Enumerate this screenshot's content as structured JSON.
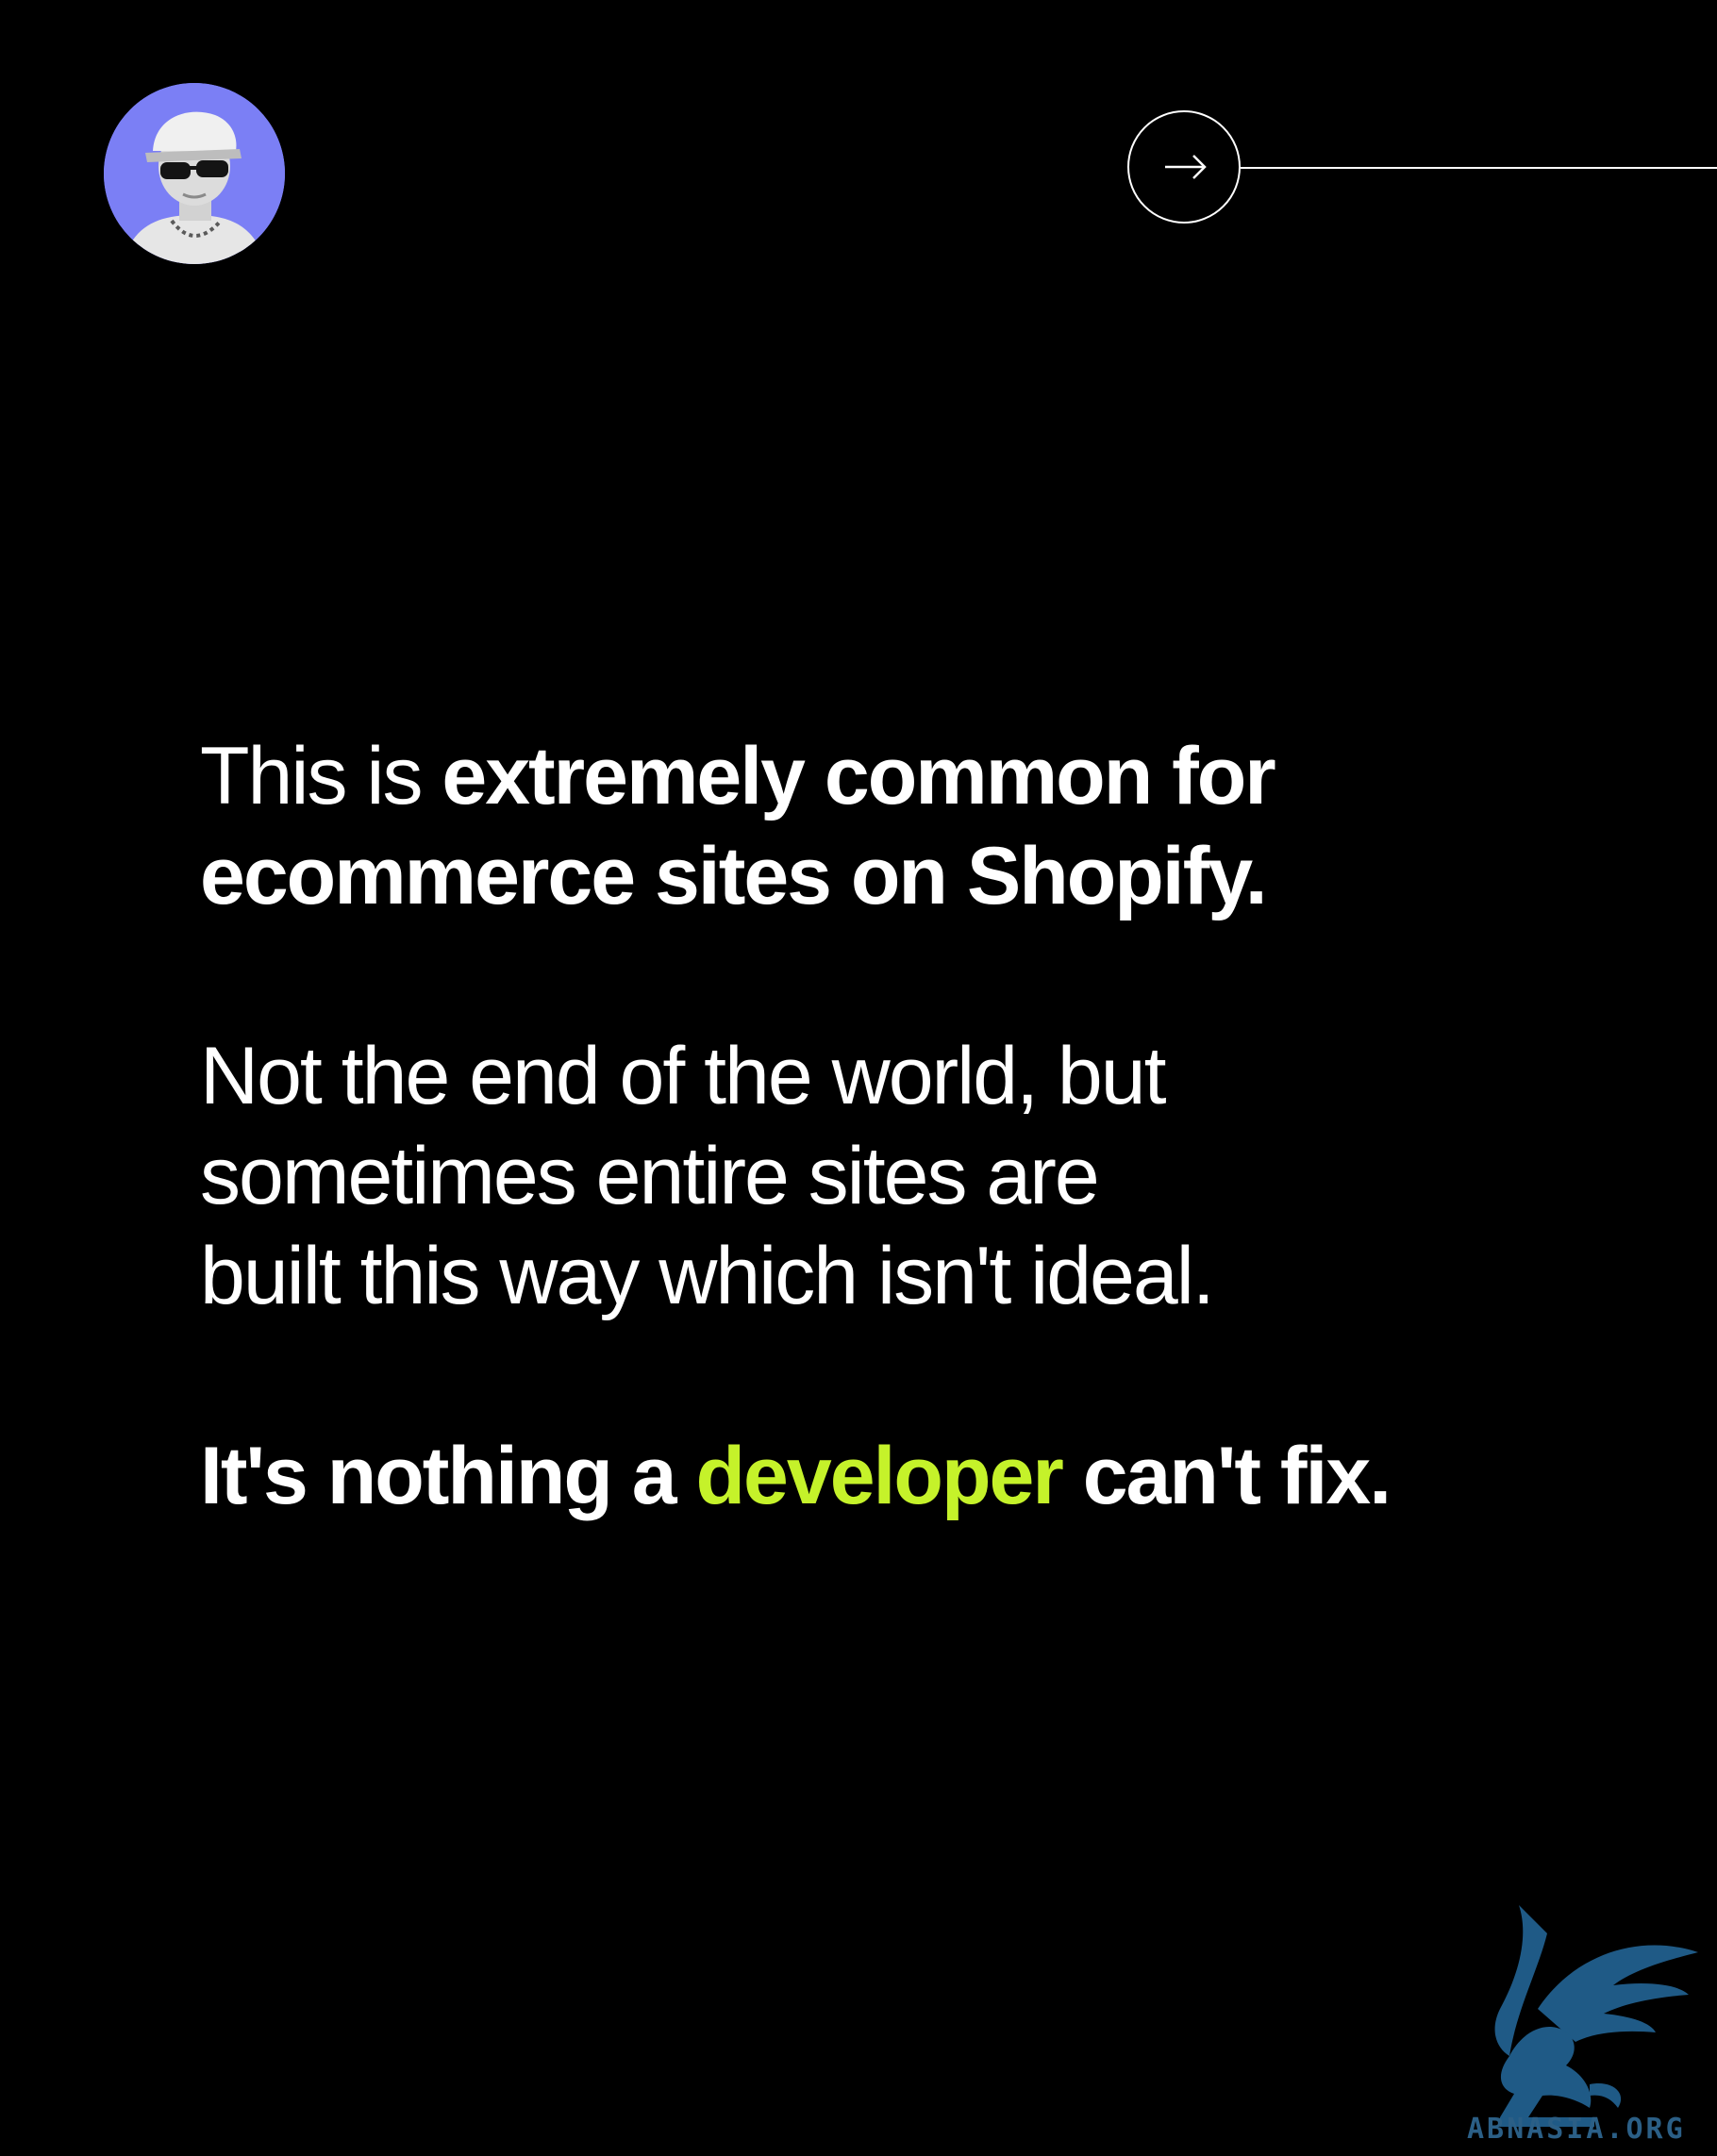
{
  "colors": {
    "background": "#000000",
    "text": "#ffffff",
    "accent": "#c5f22a",
    "avatar_bg": "#7b7ff5",
    "logo": "#1f5a86"
  },
  "header": {
    "avatar_icon": "avatar-photo",
    "next_icon": "arrow-right-icon"
  },
  "para1": {
    "line1_light": "This is ",
    "line1_bold": "extremely common for",
    "line2_bold": "ecommerce sites on Shopify."
  },
  "para2": {
    "line1": "Not the end of the world, but",
    "line2": "sometimes entire sites are",
    "line3": "built this way which isn't ideal."
  },
  "para3": {
    "before": "It's nothing a ",
    "accent_word": "developer",
    "after": " can't fix."
  },
  "watermark": {
    "text": "ABNASIA.ORG",
    "icon": "griffin-logo-icon"
  }
}
